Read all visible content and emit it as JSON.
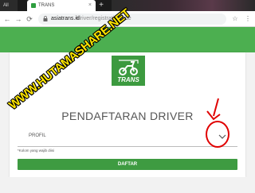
{
  "browser": {
    "tab_left_label": "All",
    "active_tab_title": "TRANS",
    "tab_close": "×",
    "new_tab": "+",
    "url_host": "asiatrans.id",
    "url_path": "/driver/registration/ride",
    "nav_back": "←",
    "nav_forward": "→",
    "nav_reload": "⟳"
  },
  "logo": {
    "text": "TRANS",
    "color": "#3c9a3f"
  },
  "page": {
    "title": "PENDAFTARAN DRIVER",
    "profil_label": "PROFIL",
    "required_note": "*Kolom yang wajib diisi",
    "submit_label": "DAFTAR"
  },
  "watermark": {
    "text": "WWW.HUTAMASHARE.NET"
  },
  "colors": {
    "brand_green": "#4caf50",
    "button_green": "#3e9b41",
    "annotation_red": "#e00000",
    "watermark_yellow": "#ffe600"
  },
  "icons": [
    "lock-icon",
    "scooter-logo-icon",
    "chevron-down-icon",
    "star-icon",
    "menu-icon"
  ]
}
